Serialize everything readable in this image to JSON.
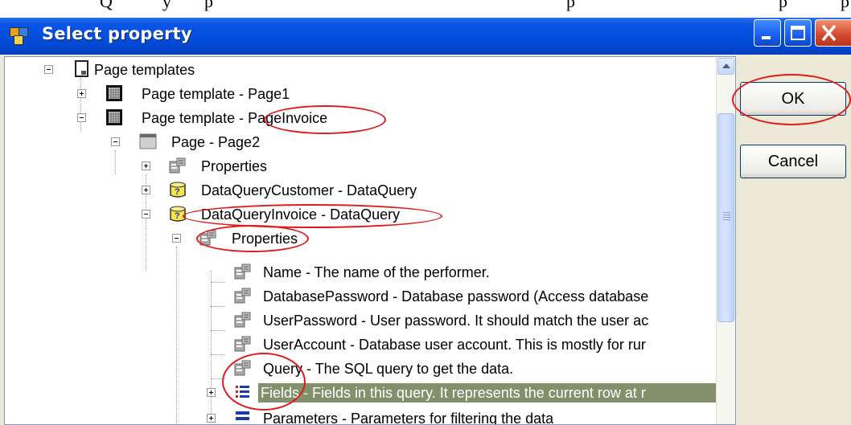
{
  "page": {
    "top_text_fragments": [
      "Q",
      "y",
      "p",
      "p",
      "p",
      "p"
    ]
  },
  "window": {
    "title": "Select property",
    "minimize_glyph": "–",
    "maximize_glyph": "□",
    "close_glyph": "✕"
  },
  "buttons": {
    "ok": "OK",
    "cancel": "Cancel"
  },
  "tree": {
    "page_templates": "Page templates",
    "page_template_page1": "Page template - Page1",
    "page_template_pageinvoice": "Page template - PageInvoice",
    "page_page2": "Page - Page2",
    "page2_properties": "Properties",
    "dq_customer": "DataQueryCustomer - DataQuery",
    "dq_invoice": "DataQueryInvoice - DataQuery",
    "dq_invoice_properties": "Properties",
    "prop_name": "Name - The name of the performer.",
    "prop_dbpassword": "DatabasePassword - Database password (Access database",
    "prop_userpassword": "UserPassword - User password. It should match the user ac",
    "prop_useraccount": "UserAccount - Database user account. This is mostly for rur",
    "prop_query": "Query - The SQL query to get the data.",
    "fields": "Fields - Fields in this query. It represents the current row at r",
    "parameters_partial": "Parameters - Parameters for filtering the data"
  },
  "colors": {
    "titlebar": "#0350dc",
    "selection": "#82906b",
    "annotation": "#e01b1b"
  },
  "icons": {
    "window": "application-window-icon",
    "page_templates": "document-icon",
    "page_template": "grid-template-icon",
    "page": "page-icon",
    "properties": "properties-icon",
    "dataquery": "dataquery-icon",
    "fields": "fields-list-icon"
  }
}
